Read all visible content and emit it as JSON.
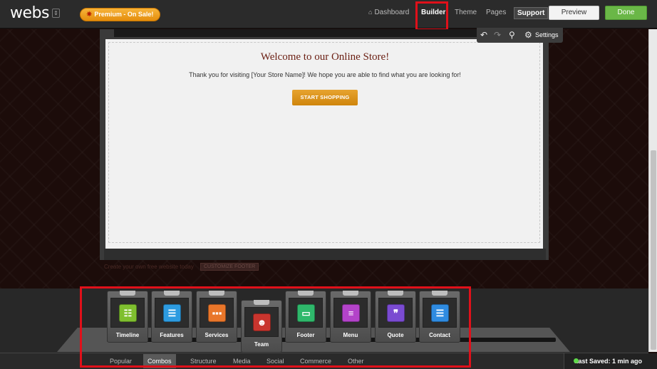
{
  "topbar": {
    "logo": "webs",
    "logo_menu_icon": "⇕",
    "premium_label": "Premium - On Sale!",
    "nav": {
      "dashboard": "Dashboard",
      "builder": "Builder",
      "theme": "Theme",
      "pages": "Pages",
      "support": "Support"
    },
    "preview_label": "Preview",
    "done_label": "Done"
  },
  "toolbar": {
    "settings_label": "Settings",
    "icons": [
      "undo-icon",
      "redo-icon",
      "search-icon",
      "gear-icon"
    ]
  },
  "page": {
    "welcome": "Welcome to our Online Store!",
    "thanks": "Thank you for visiting [Your Store Name]!  We hope you are able to find what you are looking for!",
    "shop_button": "START SHOPPING"
  },
  "footer": {
    "text": "Create your own free website today",
    "customize_label": "CUSTOMIZE FOOTER"
  },
  "widgets": [
    {
      "label": "Timeline",
      "color": "#7fbf2f",
      "icon": "timeline-icon"
    },
    {
      "label": "Features",
      "color": "#2d9be0",
      "icon": "features-icon"
    },
    {
      "label": "Services",
      "color": "#e9762a",
      "icon": "services-icon"
    },
    {
      "label": "Team",
      "color": "#c9352e",
      "icon": "team-icon"
    },
    {
      "label": "Footer",
      "color": "#2fb86b",
      "icon": "footer-icon"
    },
    {
      "label": "Menu",
      "color": "#b343c9",
      "icon": "menu-icon"
    },
    {
      "label": "Quote",
      "color": "#7a4bd1",
      "icon": "quote-icon"
    },
    {
      "label": "Contact",
      "color": "#2f8be0",
      "icon": "contact-icon"
    }
  ],
  "categories": [
    "Popular",
    "Combos",
    "Structure",
    "Media",
    "Social",
    "Commerce",
    "Other"
  ],
  "active_category": "Combos",
  "status": {
    "last_saved": "Last Saved: 1 min ago"
  },
  "colors": {
    "accent_done": "#6ab747",
    "premium": "#f0a020",
    "highlight_box": "#e0101a"
  }
}
